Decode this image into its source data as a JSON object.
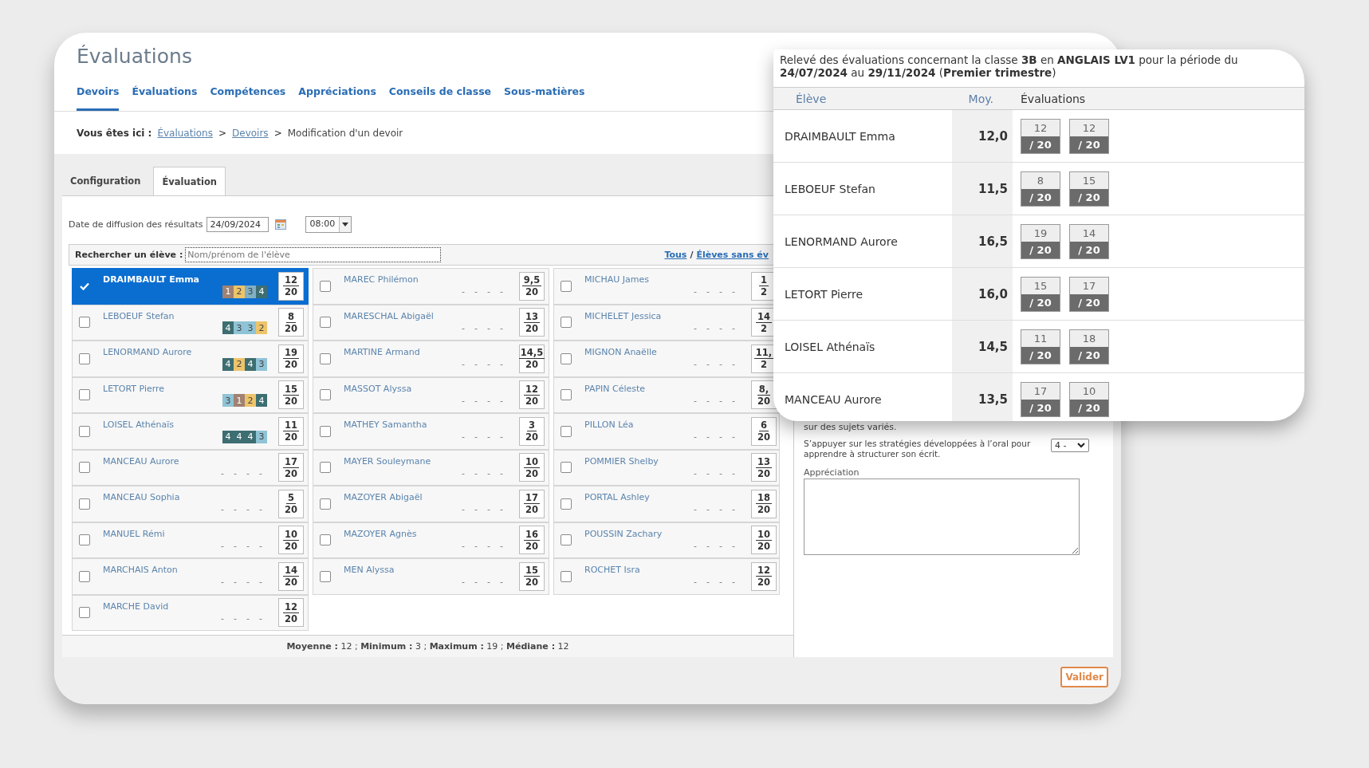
{
  "page": {
    "title": "Évaluations"
  },
  "nav": [
    {
      "label": "Devoirs",
      "selected": true
    },
    {
      "label": "Évaluations",
      "selected": false
    },
    {
      "label": "Compétences",
      "selected": false
    },
    {
      "label": "Appréciations",
      "selected": false
    },
    {
      "label": "Conseils de classe",
      "selected": false
    },
    {
      "label": "Sous-matières",
      "selected": false
    }
  ],
  "breadcrumb": {
    "prefix": "Vous êtes ici :",
    "parts": [
      {
        "kind": "link",
        "text": "Évaluations"
      },
      {
        "kind": "sep",
        "text": ">"
      },
      {
        "kind": "link",
        "text": "Devoirs"
      },
      {
        "kind": "sep",
        "text": ">"
      },
      {
        "kind": "current",
        "text": "Modification d'un devoir"
      }
    ]
  },
  "subtabs": [
    {
      "label": "Configuration",
      "selected": false
    },
    {
      "label": "Évaluation",
      "selected": true
    }
  ],
  "publish": {
    "label": "Date de diffusion des résultats",
    "date": "24/09/2024",
    "time": "08:00"
  },
  "search": {
    "label": "Rechercher un élève :",
    "placeholder": "Nom/prénom de l'élève",
    "links": [
      {
        "kind": "link",
        "text": "Tous"
      },
      {
        "kind": "sep",
        "text": "/"
      },
      {
        "kind": "link",
        "text": "Élèves sans év"
      }
    ]
  },
  "columns": [
    [
      {
        "name": "DRAIMBAULT Emma",
        "checked": true,
        "skills": [
          {
            "value": "1",
            "color": "#a08272"
          },
          {
            "value": "2",
            "color": "#eec46a"
          },
          {
            "value": "3",
            "color": "#7fb0c4"
          },
          {
            "value": "4",
            "color": "#3d6e72"
          }
        ],
        "grade": "12",
        "out_of": "20"
      },
      {
        "name": "LEBOEUF Stefan",
        "checked": false,
        "skills": [
          {
            "value": "4",
            "color": "#3d6e72"
          },
          {
            "value": "3",
            "color": "#8fc3d6"
          },
          {
            "value": "3",
            "color": "#8fc3d6"
          },
          {
            "value": "2",
            "color": "#eec46a"
          }
        ],
        "grade": "8",
        "out_of": "20"
      },
      {
        "name": "LENORMAND Aurore",
        "checked": false,
        "skills": [
          {
            "value": "4",
            "color": "#3d6e72"
          },
          {
            "value": "2",
            "color": "#eec46a"
          },
          {
            "value": "4",
            "color": "#3d6e72"
          },
          {
            "value": "3",
            "color": "#8fc3d6"
          }
        ],
        "grade": "19",
        "out_of": "20"
      },
      {
        "name": "LETORT Pierre",
        "checked": false,
        "skills": [
          {
            "value": "3",
            "color": "#8fc3d6"
          },
          {
            "value": "1",
            "color": "#a08272"
          },
          {
            "value": "2",
            "color": "#eec46a"
          },
          {
            "value": "4",
            "color": "#3d6e72"
          }
        ],
        "grade": "15",
        "out_of": "20"
      },
      {
        "name": "LOISEL Athénaïs",
        "checked": false,
        "skills": [
          {
            "value": "4",
            "color": "#3d6e72"
          },
          {
            "value": "4",
            "color": "#3d6e72"
          },
          {
            "value": "4",
            "color": "#3d6e72"
          },
          {
            "value": "3",
            "color": "#8fc3d6"
          }
        ],
        "grade": "11",
        "out_of": "20"
      },
      {
        "name": "MANCEAU Aurore",
        "checked": false,
        "skills": [
          {
            "value": "-"
          },
          {
            "value": "-"
          },
          {
            "value": "-"
          },
          {
            "value": "-"
          }
        ],
        "grade": "17",
        "out_of": "20"
      },
      {
        "name": "MANCEAU Sophia",
        "checked": false,
        "skills": [
          {
            "value": "-"
          },
          {
            "value": "-"
          },
          {
            "value": "-"
          },
          {
            "value": "-"
          }
        ],
        "grade": "5",
        "out_of": "20"
      },
      {
        "name": "MANUEL Rémi",
        "checked": false,
        "skills": [
          {
            "value": "-"
          },
          {
            "value": "-"
          },
          {
            "value": "-"
          },
          {
            "value": "-"
          }
        ],
        "grade": "10",
        "out_of": "20"
      },
      {
        "name": "MARCHAIS Anton",
        "checked": false,
        "skills": [
          {
            "value": "-"
          },
          {
            "value": "-"
          },
          {
            "value": "-"
          },
          {
            "value": "-"
          }
        ],
        "grade": "14",
        "out_of": "20"
      },
      {
        "name": "MARCHE David",
        "checked": false,
        "skills": [
          {
            "value": "-"
          },
          {
            "value": "-"
          },
          {
            "value": "-"
          },
          {
            "value": "-"
          }
        ],
        "grade": "12",
        "out_of": "20"
      }
    ],
    [
      {
        "name": "MAREC Philémon",
        "checked": false,
        "skills": [
          {
            "value": "-"
          },
          {
            "value": "-"
          },
          {
            "value": "-"
          },
          {
            "value": "-"
          }
        ],
        "grade": "9,5",
        "out_of": "20"
      },
      {
        "name": "MARESCHAL Abigaël",
        "checked": false,
        "skills": [
          {
            "value": "-"
          },
          {
            "value": "-"
          },
          {
            "value": "-"
          },
          {
            "value": "-"
          }
        ],
        "grade": "13",
        "out_of": "20"
      },
      {
        "name": "MARTINE Armand",
        "checked": false,
        "skills": [
          {
            "value": "-"
          },
          {
            "value": "-"
          },
          {
            "value": "-"
          },
          {
            "value": "-"
          }
        ],
        "grade": "14,5",
        "out_of": "20"
      },
      {
        "name": "MASSOT Alyssa",
        "checked": false,
        "skills": [
          {
            "value": "-"
          },
          {
            "value": "-"
          },
          {
            "value": "-"
          },
          {
            "value": "-"
          }
        ],
        "grade": "12",
        "out_of": "20"
      },
      {
        "name": "MATHEY Samantha",
        "checked": false,
        "skills": [
          {
            "value": "-"
          },
          {
            "value": "-"
          },
          {
            "value": "-"
          },
          {
            "value": "-"
          }
        ],
        "grade": "3",
        "out_of": "20"
      },
      {
        "name": "MAYER Souleymane",
        "checked": false,
        "skills": [
          {
            "value": "-"
          },
          {
            "value": "-"
          },
          {
            "value": "-"
          },
          {
            "value": "-"
          }
        ],
        "grade": "10",
        "out_of": "20"
      },
      {
        "name": "MAZOYER Abigaël",
        "checked": false,
        "skills": [
          {
            "value": "-"
          },
          {
            "value": "-"
          },
          {
            "value": "-"
          },
          {
            "value": "-"
          }
        ],
        "grade": "17",
        "out_of": "20"
      },
      {
        "name": "MAZOYER Agnès",
        "checked": false,
        "skills": [
          {
            "value": "-"
          },
          {
            "value": "-"
          },
          {
            "value": "-"
          },
          {
            "value": "-"
          }
        ],
        "grade": "16",
        "out_of": "20"
      },
      {
        "name": "MEN Alyssa",
        "checked": false,
        "skills": [
          {
            "value": "-"
          },
          {
            "value": "-"
          },
          {
            "value": "-"
          },
          {
            "value": "-"
          }
        ],
        "grade": "15",
        "out_of": "20"
      }
    ],
    [
      {
        "name": "MICHAU James",
        "checked": false,
        "skills": [
          {
            "value": "-"
          },
          {
            "value": "-"
          },
          {
            "value": "-"
          },
          {
            "value": "-"
          }
        ],
        "grade": "1",
        "out_of": "2"
      },
      {
        "name": "MICHELET Jessica",
        "checked": false,
        "skills": [
          {
            "value": "-"
          },
          {
            "value": "-"
          },
          {
            "value": "-"
          },
          {
            "value": "-"
          }
        ],
        "grade": "14",
        "out_of": "2"
      },
      {
        "name": "MIGNON Anaëlle",
        "checked": false,
        "skills": [
          {
            "value": "-"
          },
          {
            "value": "-"
          },
          {
            "value": "-"
          },
          {
            "value": "-"
          }
        ],
        "grade": "11,",
        "out_of": "2"
      },
      {
        "name": "PAPIN Céleste",
        "checked": false,
        "skills": [
          {
            "value": "-"
          },
          {
            "value": "-"
          },
          {
            "value": "-"
          },
          {
            "value": "-"
          }
        ],
        "grade": "8,",
        "out_of": "20"
      },
      {
        "name": "PILLON Léa",
        "checked": false,
        "skills": [
          {
            "value": "-"
          },
          {
            "value": "-"
          },
          {
            "value": "-"
          },
          {
            "value": "-"
          }
        ],
        "grade": "6",
        "out_of": "20"
      },
      {
        "name": "POMMIER Shelby",
        "checked": false,
        "skills": [
          {
            "value": "-"
          },
          {
            "value": "-"
          },
          {
            "value": "-"
          },
          {
            "value": "-"
          }
        ],
        "grade": "13",
        "out_of": "20"
      },
      {
        "name": "PORTAL Ashley",
        "checked": false,
        "skills": [
          {
            "value": "-"
          },
          {
            "value": "-"
          },
          {
            "value": "-"
          },
          {
            "value": "-"
          }
        ],
        "grade": "18",
        "out_of": "20"
      },
      {
        "name": "POUSSIN Zachary",
        "checked": false,
        "skills": [
          {
            "value": "-"
          },
          {
            "value": "-"
          },
          {
            "value": "-"
          },
          {
            "value": "-"
          }
        ],
        "grade": "10",
        "out_of": "20"
      },
      {
        "name": "ROCHET Isra",
        "checked": false,
        "skills": [
          {
            "value": "-"
          },
          {
            "value": "-"
          },
          {
            "value": "-"
          },
          {
            "value": "-"
          }
        ],
        "grade": "12",
        "out_of": "20"
      }
    ]
  ],
  "stats": "**Moyenne :** 12 ; **Minimum :** 3 ; **Maximum :** 19 ; **Médiane :** 12",
  "panel": {
    "partial_text": "sur des sujets variés.",
    "criterion": {
      "label": "S’appuyer sur les stratégies développées à l’oral pour apprendre à structurer son écrit.",
      "value": "4 -"
    },
    "comment_label": "Appréciation"
  },
  "submit": "Valider",
  "report": {
    "heading": "Relevé des évaluations concernant la classe **3B** en **ANGLAIS LV1** pour la période du **24/07/2024** au **29/11/2024** (**Premier trimestre**)",
    "columns": [
      "Élève",
      "Moy.",
      "Évaluations"
    ],
    "rows": [
      {
        "name": "DRAIMBAULT Emma",
        "average": "12,0",
        "evaluations": [
          {
            "score": "12",
            "out_of": "/ 20"
          },
          {
            "score": "12",
            "out_of": "/ 20"
          }
        ]
      },
      {
        "name": "LEBOEUF Stefan",
        "average": "11,5",
        "evaluations": [
          {
            "score": "8",
            "out_of": "/ 20"
          },
          {
            "score": "15",
            "out_of": "/ 20"
          }
        ]
      },
      {
        "name": "LENORMAND Aurore",
        "average": "16,5",
        "evaluations": [
          {
            "score": "19",
            "out_of": "/ 20"
          },
          {
            "score": "14",
            "out_of": "/ 20"
          }
        ]
      },
      {
        "name": "LETORT Pierre",
        "average": "16,0",
        "evaluations": [
          {
            "score": "15",
            "out_of": "/ 20"
          },
          {
            "score": "17",
            "out_of": "/ 20"
          }
        ]
      },
      {
        "name": "LOISEL Athénaïs",
        "average": "14,5",
        "evaluations": [
          {
            "score": "11",
            "out_of": "/ 20"
          },
          {
            "score": "18",
            "out_of": "/ 20"
          }
        ]
      },
      {
        "name": "MANCEAU Aurore",
        "average": "13,5",
        "evaluations": [
          {
            "score": "17",
            "out_of": "/ 20"
          },
          {
            "score": "10",
            "out_of": "/ 20"
          }
        ]
      }
    ]
  }
}
